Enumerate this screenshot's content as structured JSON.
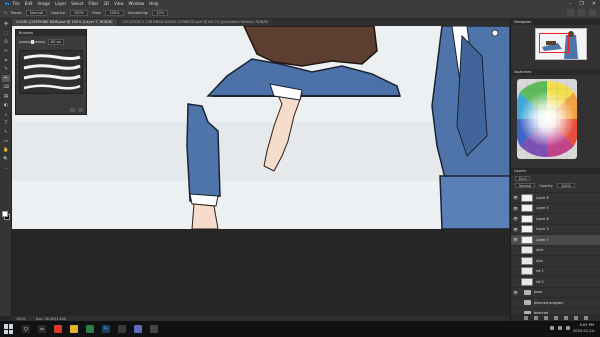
{
  "app": {
    "logo": "Ps",
    "menu": [
      "File",
      "Edit",
      "Image",
      "Layer",
      "Select",
      "Filter",
      "3D",
      "View",
      "Window",
      "Help"
    ],
    "window_controls": [
      "–",
      "❐",
      "✕"
    ]
  },
  "options_bar": {
    "mode_label": "Mode:",
    "mode_value": "Normal",
    "opacity_label": "Opacity:",
    "opacity_value": "100%",
    "flow_label": "Flow:",
    "flow_value": "100%",
    "smoothing_label": "Smoothing:",
    "smoothing_value": "10%"
  },
  "document_tabs": [
    "CHARL JOSEPHINE NEW.psd @ 100% (Layer 7, RGB/8)",
    "LOCATION 1 256 BBG#1W2W 129WR3D.psd @ 66.7% (Josephine frames, RGB/8)"
  ],
  "tools": [
    "✥",
    "⬚",
    "ʘ",
    "✂",
    "⌗",
    "✎",
    "✒",
    "⌫",
    "▤",
    "◐",
    "⌕",
    "T",
    "↖",
    "▭",
    "✋",
    "🔍",
    "…"
  ],
  "brush_panel": {
    "title": "Brushes",
    "size_value": "60 px"
  },
  "navigator": {
    "title": "Navigator"
  },
  "swatches": {
    "title": "Swatches"
  },
  "layers_panel": {
    "title": "Layers",
    "kind_label": "Kind",
    "blend_mode": "Normal",
    "opacity_label": "Opacity:",
    "opacity_value": "100%",
    "lock_label": "Lock:",
    "fill_label": "Fill:",
    "fill_value": "100%",
    "layers": [
      {
        "name": "Layer 8",
        "type": "layer",
        "selected": false
      },
      {
        "name": "Layer 5",
        "type": "layer",
        "selected": false
      },
      {
        "name": "Layer 6",
        "type": "layer",
        "selected": false
      },
      {
        "name": "Layer 3",
        "type": "layer",
        "selected": false
      },
      {
        "name": "Layer 7",
        "type": "layer",
        "selected": true
      },
      {
        "name": "shirt",
        "type": "layer",
        "selected": false
      },
      {
        "name": "skin",
        "type": "layer",
        "selected": false
      },
      {
        "name": "ref 1",
        "type": "layer",
        "selected": false
      },
      {
        "name": "ref 2",
        "type": "layer",
        "selected": false
      },
      {
        "name": "pose",
        "type": "folder",
        "selected": false
      },
      {
        "name": "directed program",
        "type": "folder",
        "selected": false
      },
      {
        "name": "directed",
        "type": "folder",
        "selected": false
      }
    ]
  },
  "status_bar": {
    "zoom": "100%",
    "doc_info": "Doc: 26.4M/1.40G"
  },
  "taskbar": {
    "time": "4:03 PM",
    "date": "2020-01-24"
  },
  "colors": {
    "canvas_bg": "#eceff1",
    "suit_blue": "#4a6fa5",
    "hair_brown": "#5a3e30",
    "skin": "#f2d3bd"
  }
}
